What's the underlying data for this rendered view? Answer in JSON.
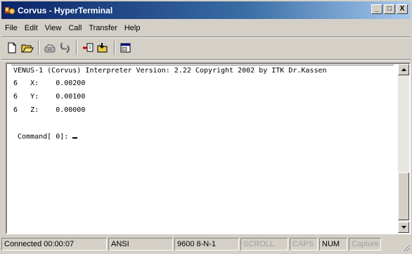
{
  "window": {
    "title": "Corvus - HyperTerminal",
    "buttons": {
      "minimize": "_",
      "maximize": "□",
      "close": "X"
    }
  },
  "menu": [
    "File",
    "Edit",
    "View",
    "Call",
    "Transfer",
    "Help"
  ],
  "toolbar": {
    "icons": [
      "new-document-icon",
      "open-folder-icon",
      "call-icon",
      "disconnect-icon",
      "send-file-icon",
      "receive-file-icon",
      "properties-icon"
    ]
  },
  "terminal": {
    "lines": [
      "VENUS-1 (Corvus) Interpreter Version: 2.22 Copyright 2002 by ITK Dr.Kassen",
      "6   X:    0.00200",
      "6   Y:    0.00100",
      "6   Z:    0.00000",
      "",
      " Command[ 0]:"
    ]
  },
  "statusbar": {
    "connected": "Connected 00:00:07",
    "emulation": "ANSI",
    "settings": "9600 8-N-1",
    "scroll": "SCROLL",
    "caps": "CAPS",
    "num": "NUM",
    "capture": "Capture"
  },
  "colors": {
    "titlebar_start": "#0a246a",
    "titlebar_end": "#a6caf0",
    "face": "#d4d0c8"
  }
}
